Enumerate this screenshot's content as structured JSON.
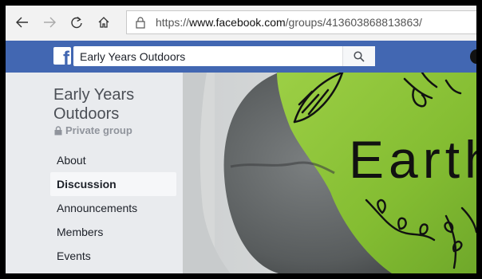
{
  "browser": {
    "url_prefix": "https://",
    "url_domain": "www.facebook.com",
    "url_path": "/groups/413603868813863/",
    "icons": [
      "back-arrow-icon",
      "forward-arrow-icon",
      "refresh-icon",
      "home-icon",
      "lock-icon"
    ]
  },
  "header": {
    "logo_letter": "f",
    "search_value": "Early Years Outdoors",
    "brand_color": "#4267b2"
  },
  "group": {
    "name": "Early Years Outdoors",
    "privacy": "Private group",
    "nav": [
      {
        "label": "About",
        "active": false
      },
      {
        "label": "Discussion",
        "active": true
      },
      {
        "label": "Announcements",
        "active": false
      },
      {
        "label": "Members",
        "active": false
      },
      {
        "label": "Events",
        "active": false
      }
    ]
  },
  "cover": {
    "painted_text": "Earth",
    "description_colors": {
      "leaf": "#8ec43a",
      "stone": "#6b6f70",
      "ground": "#d5d8d8"
    }
  }
}
